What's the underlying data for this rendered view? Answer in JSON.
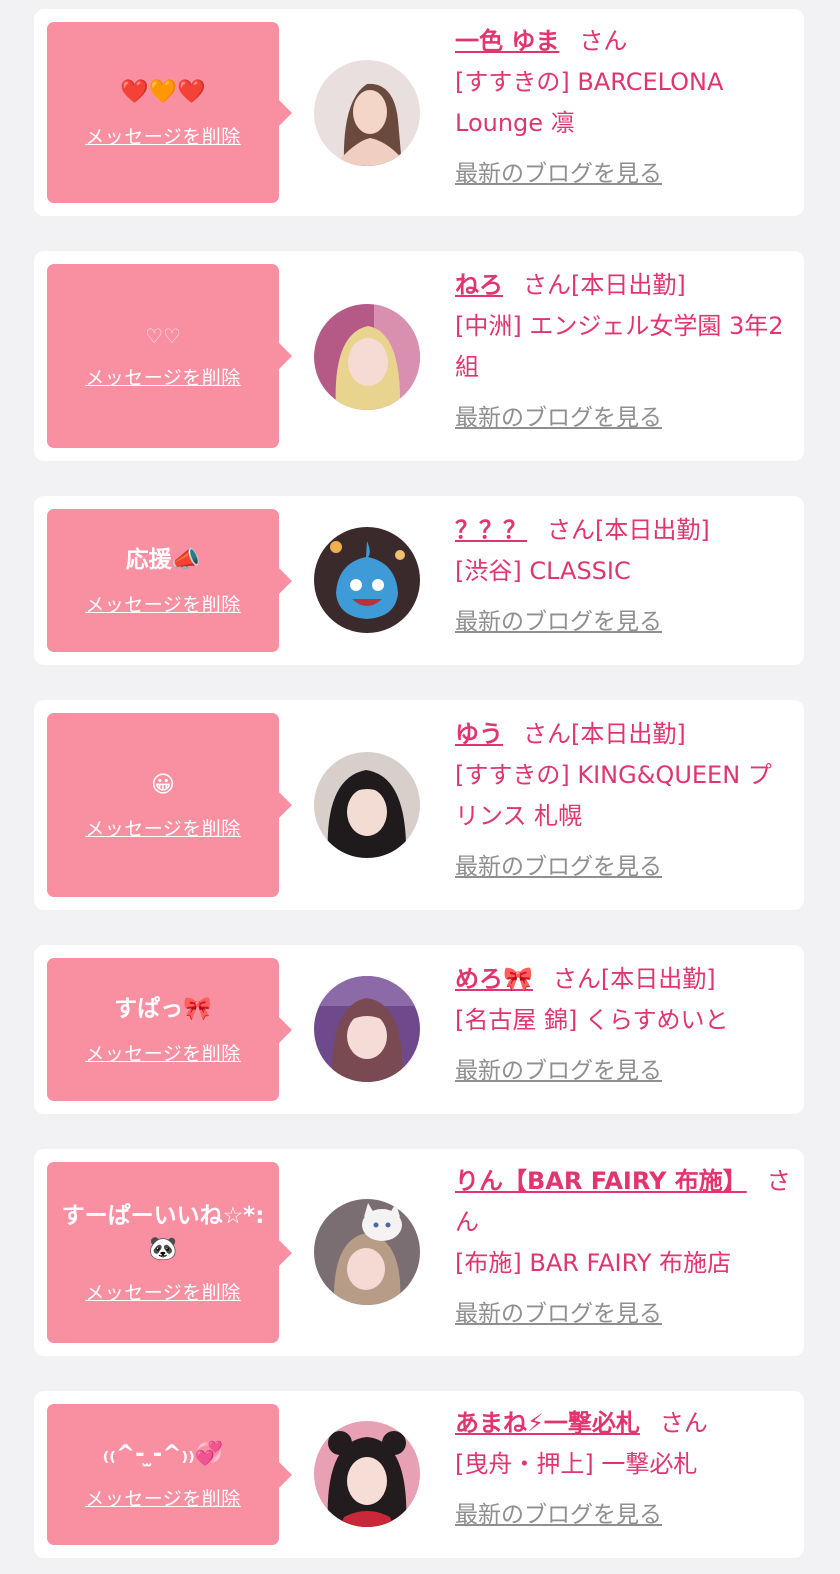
{
  "delete_label": "メッセージを削除",
  "blog_label": "最新のブログを見る",
  "san_label": "さん",
  "colors": {
    "page_bg": "#f2f2f4",
    "card_bg": "#ffffff",
    "message_box": "#f890a2",
    "accent_pink": "#e0356f",
    "link_gray": "#8f8f8f"
  },
  "cards": [
    {
      "message": "❤️🧡❤️",
      "name": "一色 ゆま",
      "status": "",
      "shop": "[すすきの] BARCELONA Lounge 凛",
      "avatar_icon": "avatar-photo"
    },
    {
      "message": "♡♡",
      "name": "ねろ",
      "status": "[本日出勤]",
      "shop": "[中洲] エンジェル女学園 3年2組",
      "avatar_icon": "avatar-photo"
    },
    {
      "message": "応援📣",
      "name": "？？？",
      "status": "[本日出勤]",
      "shop": "[渋谷] CLASSIC",
      "avatar_icon": "avatar-photo"
    },
    {
      "message": "😀",
      "name": "ゆう",
      "status": "[本日出勤]",
      "shop": "[すすきの] KING&QUEEN プリンス 札幌",
      "avatar_icon": "avatar-photo"
    },
    {
      "message": "すぱっ🎀",
      "name": "めろ🎀",
      "status": "[本日出勤]",
      "shop": "[名古屋 錦] くらすめいと",
      "avatar_icon": "avatar-photo"
    },
    {
      "message": "すーぱーいいね☆*: 🐼",
      "name": "りん【BAR FAIRY 布施】",
      "status": "",
      "shop": "[布施] BAR FAIRY 布施店",
      "avatar_icon": "avatar-photo"
    },
    {
      "message": "₍₍^- ̫-^₎₎💞",
      "name": "あまね⚡一撃必札",
      "status": "",
      "shop": "[曳舟・押上] 一撃必札",
      "avatar_icon": "avatar-photo"
    }
  ]
}
